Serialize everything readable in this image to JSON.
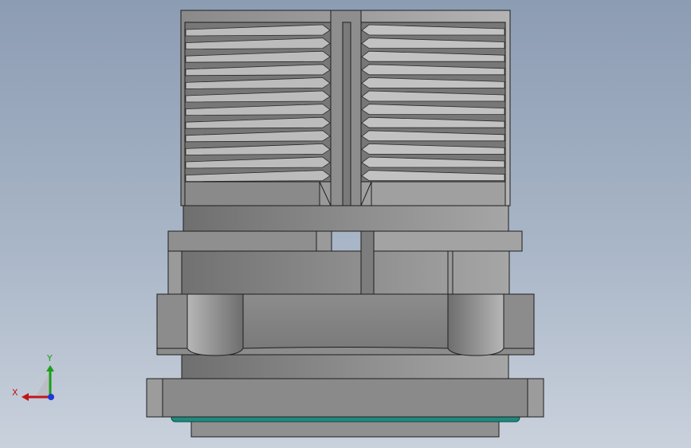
{
  "viewport": {
    "background_top": "#8c9cb3",
    "background_bottom": "#c9d1dc"
  },
  "model": {
    "body_color": "#8a8a8a",
    "edge_color": "#1e1e1e",
    "seal_color": "#1f8a7f"
  },
  "triad": {
    "x_label": "X",
    "y_label": "Y",
    "x_color": "#c0161b",
    "y_color": "#1a9e1a",
    "z_color": "#1f38d6"
  }
}
